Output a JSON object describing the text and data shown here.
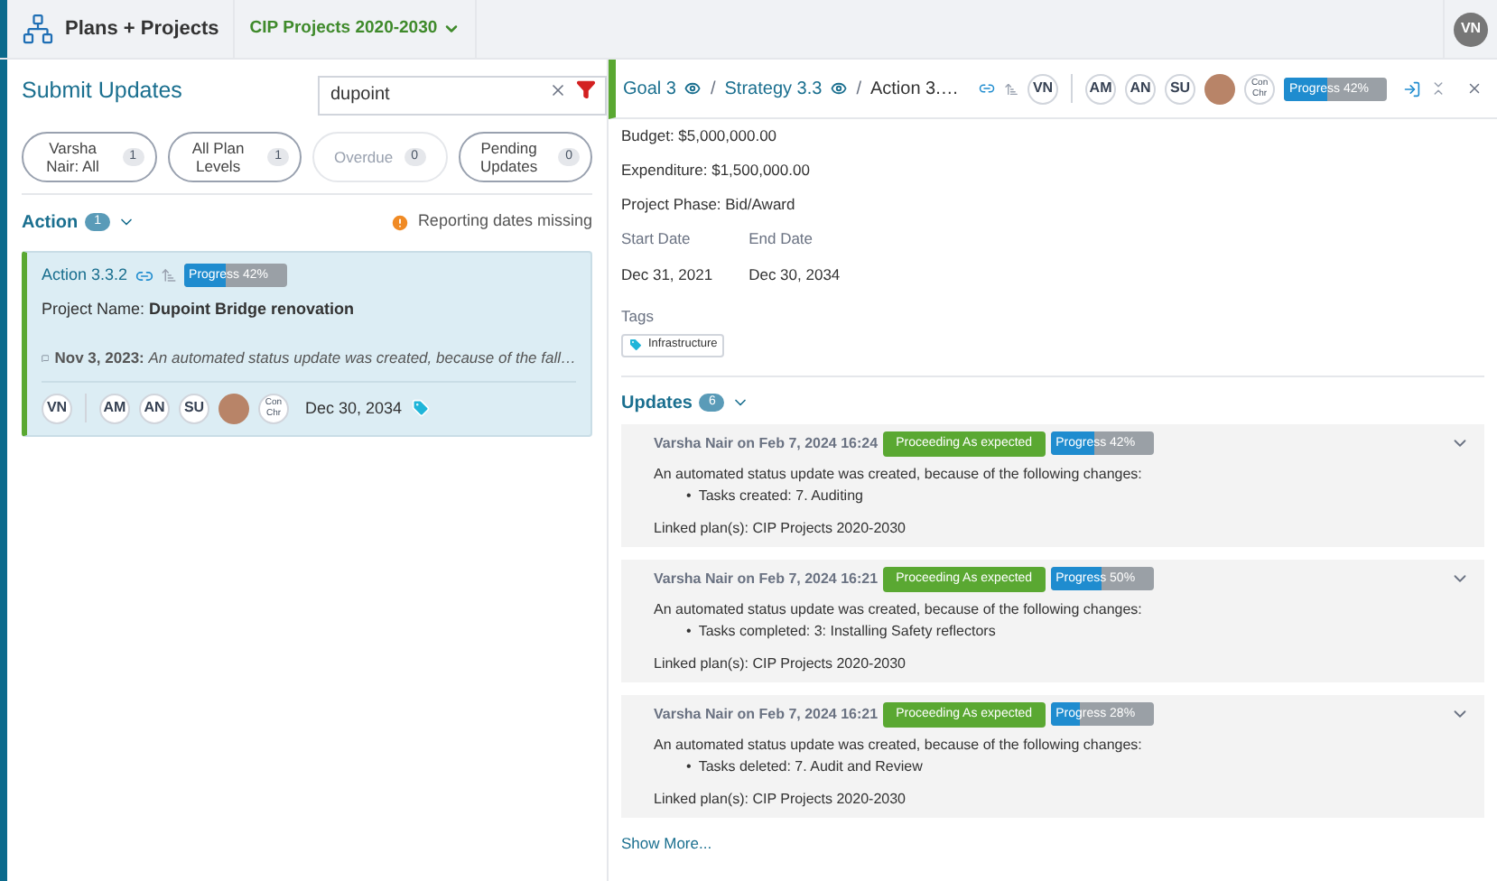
{
  "header": {
    "app_title": "Plans + Projects",
    "plan_selector": "CIP Projects 2020-2030",
    "user_initials": "VN"
  },
  "left_panel": {
    "title": "Submit Updates",
    "search": {
      "value": "dupoint"
    },
    "filters": [
      {
        "label": "Varsha Nair: All",
        "count": "1",
        "active": true
      },
      {
        "label": "All Plan Levels",
        "count": "1",
        "active": true
      },
      {
        "label": "Overdue",
        "count": "0",
        "active": false
      },
      {
        "label": "Pending Updates",
        "count": "0",
        "active": true
      }
    ],
    "section": {
      "title": "Action",
      "count": "1",
      "warning": "Reporting dates missing"
    },
    "card": {
      "id": "Action 3.3.2",
      "progress": {
        "label": "Progress 42%",
        "level": 0.42
      },
      "project_label": "Project Name:",
      "project_name": "Dupoint Bridge renovation",
      "comment_date": "Nov 3, 2023:",
      "comment": "An automated status update was created, because of the fall…",
      "end_date": "Dec 30, 2034",
      "avatars": [
        {
          "kind": "initials",
          "text": "VN"
        },
        {
          "kind": "divider"
        },
        {
          "kind": "initials",
          "text": "AM"
        },
        {
          "kind": "initials",
          "text": "AN"
        },
        {
          "kind": "initials",
          "text": "SU"
        },
        {
          "kind": "photo"
        },
        {
          "kind": "text",
          "text": "Con Chr"
        }
      ]
    }
  },
  "right_panel": {
    "breadcrumb": [
      {
        "label": "Goal 3",
        "kind": "link"
      },
      {
        "separator": "/",
        "label": "Strategy 3.3",
        "kind": "link"
      },
      {
        "separator": "/",
        "label": "Action 3.…",
        "kind": "current"
      }
    ],
    "avatars": [
      {
        "kind": "initials",
        "text": "VN"
      },
      {
        "kind": "divider"
      },
      {
        "kind": "initials",
        "text": "AM"
      },
      {
        "kind": "initials",
        "text": "AN"
      },
      {
        "kind": "initials",
        "text": "SU"
      },
      {
        "kind": "photo"
      },
      {
        "kind": "text",
        "text": "Con Chr"
      }
    ],
    "progress": {
      "label": "Progress 42%",
      "level": 0.42
    },
    "details": [
      "Budget: $5,000,000.00",
      "Expenditure: $1,500,000.00",
      "Project Phase: Bid/Award"
    ],
    "dates": [
      {
        "label": "Start Date",
        "value": "Dec 31, 2021"
      },
      {
        "label": "End Date",
        "value": "Dec 30, 2034"
      }
    ],
    "tags_label": "Tags",
    "tags": [
      "Infrastructure"
    ],
    "updates": {
      "title": "Updates",
      "count": "6",
      "show_more": "Show More...",
      "items": [
        {
          "author": "Varsha Nair on Feb 7, 2024 16:24",
          "status": "Proceeding As expected",
          "progress": {
            "label": "Progress 42%",
            "level": 0.42
          },
          "text": "An automated status update was created, because of the following changes:",
          "bullets": [
            {
              "marker": "•",
              "text": "Tasks created: 7. Auditing"
            }
          ],
          "linked": "Linked plan(s): CIP Projects 2020-2030"
        },
        {
          "author": "Varsha Nair on Feb 7, 2024 16:21",
          "status": "Proceeding As expected",
          "progress": {
            "label": "Progress 50%",
            "level": 0.5
          },
          "text": "An automated status update was created, because of the following changes:",
          "bullets": [
            {
              "marker": "•",
              "text": "Tasks completed: 3: Installing Safety reflectors"
            }
          ],
          "linked": "Linked plan(s): CIP Projects 2020-2030"
        },
        {
          "author": "Varsha Nair on Feb 7, 2024 16:21",
          "status": "Proceeding As expected",
          "progress": {
            "label": "Progress 28%",
            "level": 0.28
          },
          "text": "An automated status update was created, because of the following changes:",
          "bullets": [
            {
              "marker": "•",
              "text": "Tasks deleted: 7. Audit and Review"
            }
          ],
          "linked": "Linked plan(s): CIP Projects 2020-2030"
        }
      ]
    }
  }
}
